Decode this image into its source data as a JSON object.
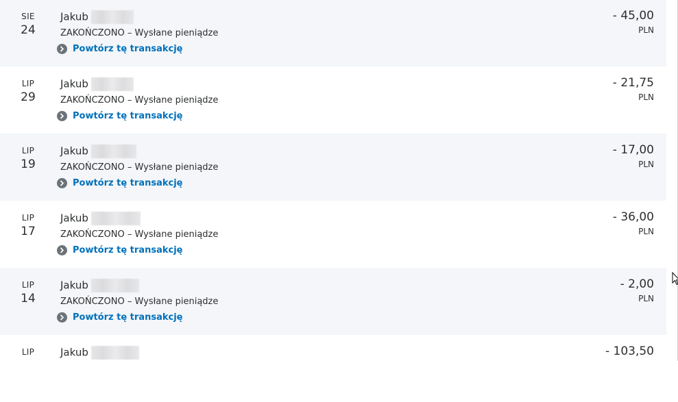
{
  "transactions": [
    {
      "month": "SIE",
      "day": "24",
      "name": "Jakub",
      "status": "ZAKOŃCZONO – Wysłane pieniądze",
      "repeat_label": "Powtórz tę transakcję",
      "amount": "- 45,00",
      "currency": "PLN"
    },
    {
      "month": "LIP",
      "day": "29",
      "name": "Jakub",
      "status": "ZAKOŃCZONO – Wysłane pieniądze",
      "repeat_label": "Powtórz tę transakcję",
      "amount": "- 21,75",
      "currency": "PLN"
    },
    {
      "month": "LIP",
      "day": "19",
      "name": "Jakub",
      "status": "ZAKOŃCZONO – Wysłane pieniądze",
      "repeat_label": "Powtórz tę transakcję",
      "amount": "- 17,00",
      "currency": "PLN"
    },
    {
      "month": "LIP",
      "day": "17",
      "name": "Jakub",
      "status": "ZAKOŃCZONO – Wysłane pieniądze",
      "repeat_label": "Powtórz tę transakcję",
      "amount": "- 36,00",
      "currency": "PLN"
    },
    {
      "month": "LIP",
      "day": "14",
      "name": "Jakub",
      "status": "ZAKOŃCZONO – Wysłane pieniądze",
      "repeat_label": "Powtórz tę transakcję",
      "amount": "- 2,00",
      "currency": "PLN"
    },
    {
      "month": "LIP",
      "day": "",
      "name": "Jakub",
      "status": "",
      "repeat_label": "",
      "amount": "- 103,50",
      "currency": ""
    }
  ],
  "icons": {
    "repeat": "chevron-right-circle-icon",
    "cursor": "mouse-cursor-icon"
  },
  "colors": {
    "link": "#0070ba",
    "row_shaded": "#f4f6f9",
    "text": "#2c2e2f",
    "icon_bg": "#6c7378"
  }
}
